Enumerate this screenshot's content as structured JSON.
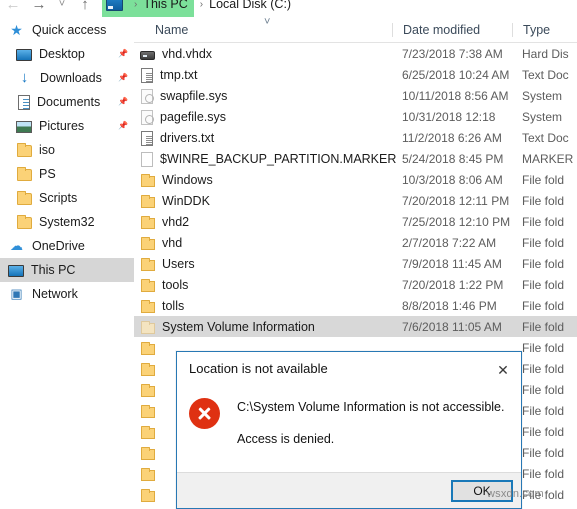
{
  "window": {
    "nav": {
      "back_icon": "arrow-left-icon",
      "forward_icon": "arrow-right-icon",
      "recent_icon": "chevron-down-icon",
      "up_icon": "arrow-up-icon"
    },
    "breadcrumb": {
      "pc_icon": "this-pc-icon",
      "items": [
        "This PC",
        "Local Disk (C:)"
      ],
      "separator": "›"
    }
  },
  "sidebar": {
    "items": [
      {
        "label": "Quick access",
        "icon": "star-icon",
        "level": "root",
        "pinned": false,
        "selected": false
      },
      {
        "label": "Desktop",
        "icon": "desktop-icon",
        "level": "child",
        "pinned": true,
        "selected": false
      },
      {
        "label": "Downloads",
        "icon": "download-icon",
        "level": "child",
        "pinned": true,
        "selected": false
      },
      {
        "label": "Documents",
        "icon": "documents-icon",
        "level": "child",
        "pinned": true,
        "selected": false
      },
      {
        "label": "Pictures",
        "icon": "pictures-icon",
        "level": "child",
        "pinned": true,
        "selected": false
      },
      {
        "label": "iso",
        "icon": "folder-icon",
        "level": "child",
        "pinned": false,
        "selected": false
      },
      {
        "label": "PS",
        "icon": "folder-icon",
        "level": "child",
        "pinned": false,
        "selected": false
      },
      {
        "label": "Scripts",
        "icon": "folder-icon",
        "level": "child",
        "pinned": false,
        "selected": false
      },
      {
        "label": "System32",
        "icon": "folder-icon",
        "level": "child",
        "pinned": false,
        "selected": false
      },
      {
        "label": "OneDrive",
        "icon": "onedrive-icon",
        "level": "root",
        "pinned": false,
        "selected": false
      },
      {
        "label": "This PC",
        "icon": "this-pc-icon",
        "level": "root",
        "pinned": false,
        "selected": true
      },
      {
        "label": "Network",
        "icon": "network-icon",
        "level": "root",
        "pinned": false,
        "selected": false
      }
    ]
  },
  "file_list": {
    "columns": [
      "Name",
      "Date modified",
      "Type"
    ],
    "sort_indicator": "chevron-up-icon",
    "rows": [
      {
        "name": "vhd.vhdx",
        "date": "7/23/2018 7:38 AM",
        "type": "Hard Dis",
        "icon": "drive-icon",
        "selected": false
      },
      {
        "name": "tmp.txt",
        "date": "6/25/2018 10:24 AM",
        "type": "Text Doc",
        "icon": "text-file-icon",
        "selected": false
      },
      {
        "name": "swapfile.sys",
        "date": "10/11/2018 8:56 AM",
        "type": "System ",
        "icon": "system-file-icon",
        "selected": false
      },
      {
        "name": "pagefile.sys",
        "date": "10/31/2018 12:18",
        "type": "System ",
        "icon": "system-file-icon",
        "selected": false
      },
      {
        "name": "drivers.txt",
        "date": "11/2/2018 6:26 AM",
        "type": "Text Doc",
        "icon": "text-file-icon",
        "selected": false
      },
      {
        "name": "$WINRE_BACKUP_PARTITION.MARKER",
        "date": "5/24/2018 8:45 PM",
        "type": "MARKER",
        "icon": "blank-file-icon",
        "selected": false
      },
      {
        "name": "Windows",
        "date": "10/3/2018 8:06 AM",
        "type": "File fold",
        "icon": "folder-icon",
        "selected": false
      },
      {
        "name": "WinDDK",
        "date": "7/20/2018 12:11 PM",
        "type": "File fold",
        "icon": "folder-icon",
        "selected": false
      },
      {
        "name": "vhd2",
        "date": "7/25/2018 12:10 PM",
        "type": "File fold",
        "icon": "folder-icon",
        "selected": false
      },
      {
        "name": "vhd",
        "date": "2/7/2018 7:22 AM",
        "type": "File fold",
        "icon": "folder-icon",
        "selected": false
      },
      {
        "name": "Users",
        "date": "7/9/2018 11:45 AM",
        "type": "File fold",
        "icon": "folder-icon",
        "selected": false
      },
      {
        "name": "tools",
        "date": "7/20/2018 1:22 PM",
        "type": "File fold",
        "icon": "folder-icon",
        "selected": false
      },
      {
        "name": "tolls",
        "date": "8/8/2018 1:46 PM",
        "type": "File fold",
        "icon": "folder-icon",
        "selected": false
      },
      {
        "name": "System Volume Information",
        "date": "7/6/2018 11:05 AM",
        "type": "File fold",
        "icon": "folder-icon-pale",
        "selected": true
      },
      {
        "name": "",
        "date": "",
        "type": "File fold",
        "icon": "folder-icon",
        "selected": false
      },
      {
        "name": "",
        "date": "",
        "type": "File fold",
        "icon": "folder-icon",
        "selected": false
      },
      {
        "name": "",
        "date": "",
        "type": "File fold",
        "icon": "folder-icon",
        "selected": false
      },
      {
        "name": "",
        "date": "",
        "type": "File fold",
        "icon": "folder-icon",
        "selected": false
      },
      {
        "name": "",
        "date": "",
        "type": "File fold",
        "icon": "folder-icon",
        "selected": false
      },
      {
        "name": "",
        "date": "",
        "type": "File fold",
        "icon": "folder-icon",
        "selected": false
      },
      {
        "name": "",
        "date": "",
        "type": "File fold",
        "icon": "folder-icon",
        "selected": false
      },
      {
        "name": "",
        "date": "",
        "type": "File fold",
        "icon": "folder-icon",
        "selected": false
      }
    ]
  },
  "dialog": {
    "title": "Location is not available",
    "close_icon": "close-icon",
    "error_icon": "error-circle-icon",
    "message_line1": "C:\\System Volume Information is not accessible.",
    "message_line2": "Access is denied.",
    "ok_label": "OK",
    "accent_color": "#1878b8",
    "error_color": "#df3112"
  },
  "watermark": {
    "text": "wsxdn.com"
  }
}
